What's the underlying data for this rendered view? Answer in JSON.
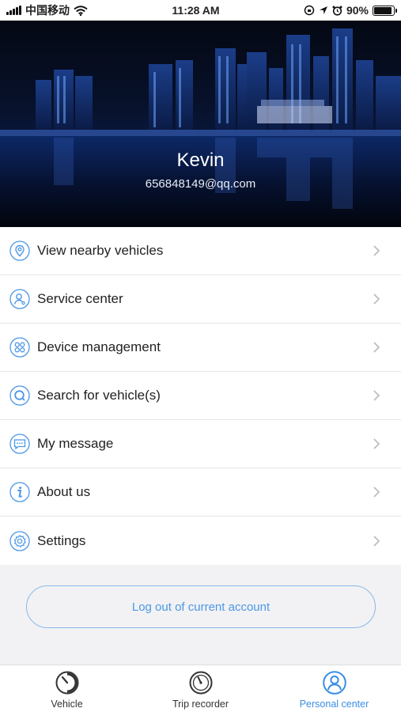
{
  "status_bar": {
    "carrier": "中国移动",
    "time": "11:28 AM",
    "battery_percent": "90%",
    "battery_level": 0.9
  },
  "profile": {
    "name": "Kevin",
    "email": "656848149@qq.com"
  },
  "menu": {
    "items": [
      {
        "label": "View nearby vehicles",
        "icon": "location-pin-icon"
      },
      {
        "label": "Service center",
        "icon": "service-person-icon"
      },
      {
        "label": "Device management",
        "icon": "device-grid-icon"
      },
      {
        "label": "Search for vehicle(s)",
        "icon": "search-icon"
      },
      {
        "label": "My message",
        "icon": "message-bubble-icon"
      },
      {
        "label": "About us",
        "icon": "info-icon"
      },
      {
        "label": "Settings",
        "icon": "gear-icon"
      }
    ]
  },
  "logout_label": "Log out of current account",
  "tabbar": {
    "tabs": [
      {
        "label": "Vehicle",
        "icon": "vehicle-gauge-icon",
        "active": false
      },
      {
        "label": "Trip recorder",
        "icon": "trip-recorder-icon",
        "active": false
      },
      {
        "label": "Personal center",
        "icon": "person-icon",
        "active": true
      }
    ]
  },
  "colors": {
    "accent": "#3a8ee6",
    "icon_blue": "#4c97e6",
    "divider": "#e6e6e9",
    "background": "#f2f2f4"
  }
}
